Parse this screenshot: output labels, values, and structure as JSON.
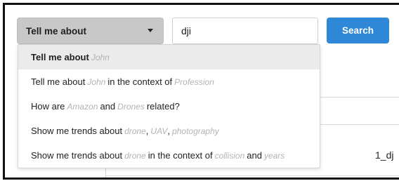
{
  "query_type": {
    "selected": "Tell me about"
  },
  "search": {
    "value": "dji",
    "button_label": "Search"
  },
  "results_table": {
    "partial_cell": "1_dj"
  },
  "dropdown": {
    "options": [
      {
        "parts": [
          "Tell me about",
          "John"
        ]
      },
      {
        "parts": [
          "Tell me about",
          "John",
          "in the context of",
          "Profession"
        ]
      },
      {
        "parts": [
          "How are",
          "Amazon",
          "and",
          "Drones",
          "related?"
        ]
      },
      {
        "parts": [
          "Show me trends about",
          "drone",
          ",",
          "UAV",
          ",",
          "photography"
        ]
      },
      {
        "parts": [
          "Show me trends about",
          "drone",
          "in the context of",
          "collision",
          "and",
          "years"
        ]
      }
    ]
  },
  "colors": {
    "accent": "#2f87d8",
    "select_bg": "#c8c8c8",
    "placeholder_text": "#b3b3b3",
    "active_option_bg": "#ebebeb"
  }
}
